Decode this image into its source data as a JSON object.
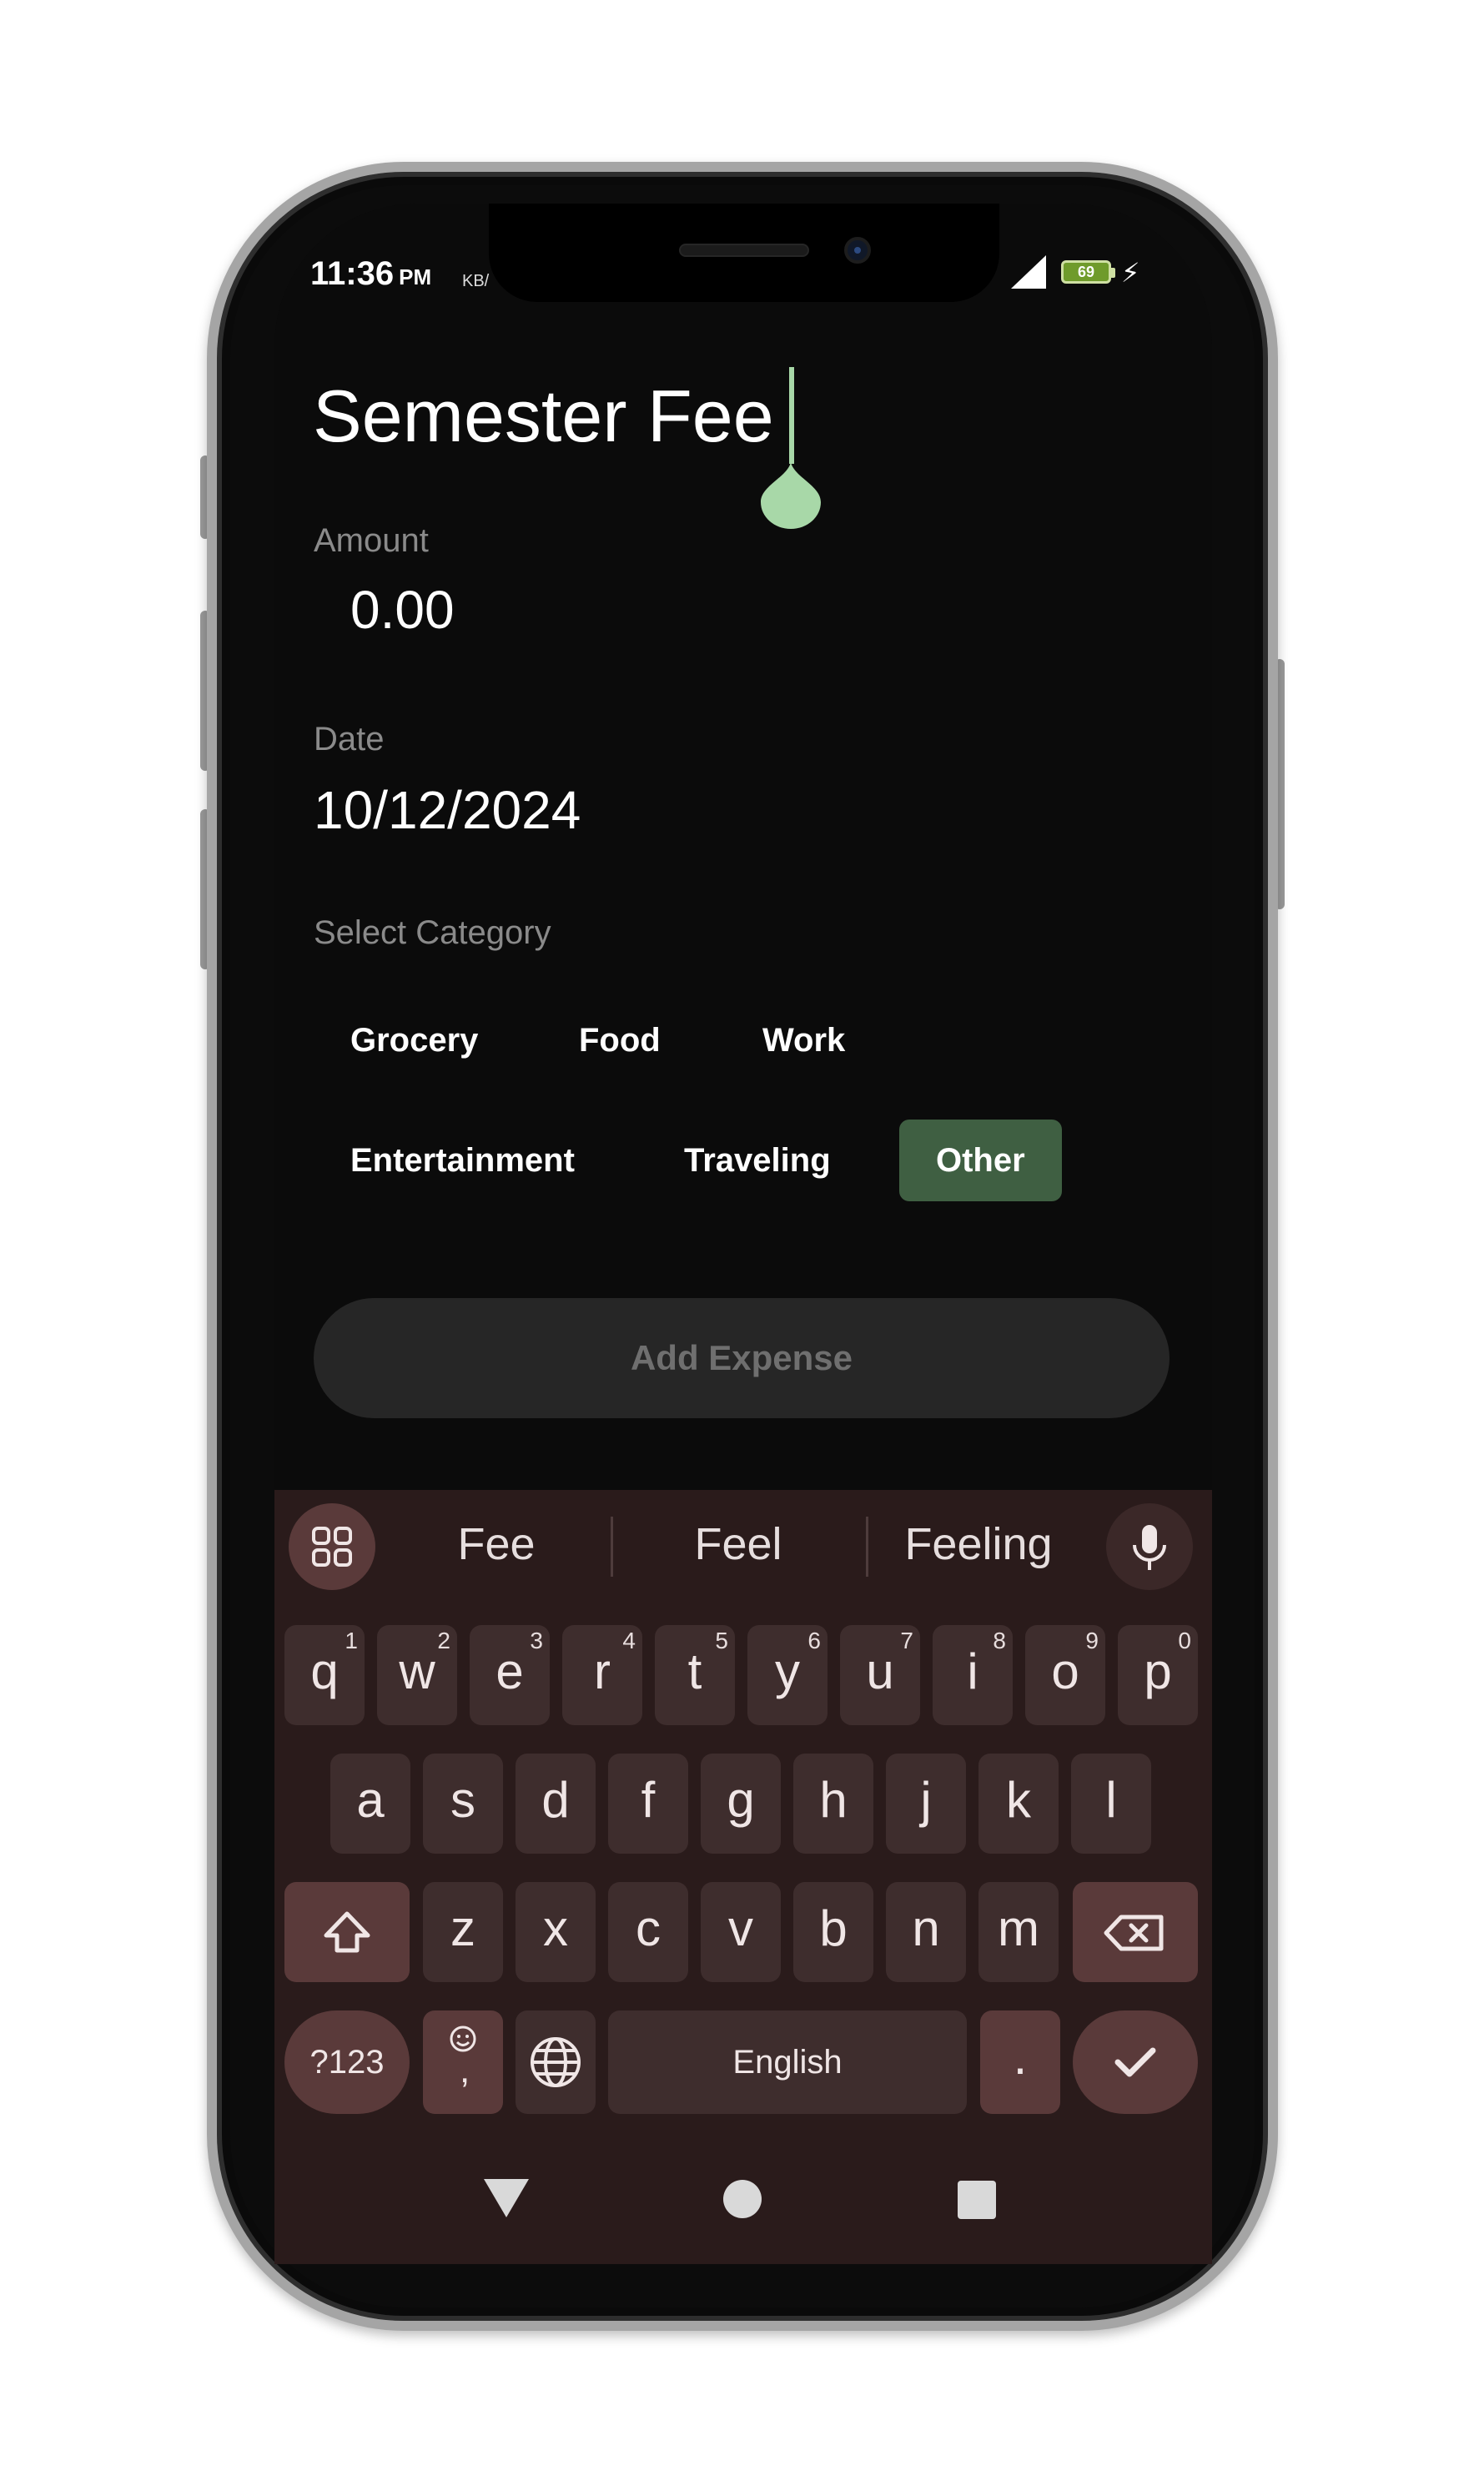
{
  "status_bar": {
    "time": "11:36",
    "ampm": "PM",
    "kb_text": "KB/",
    "battery": "69"
  },
  "form": {
    "title": "Semester Fee",
    "amount_label": "Amount",
    "amount_value": "0.00",
    "date_label": "Date",
    "date_value": "10/12/2024",
    "category_label": "Select Category",
    "categories": [
      "Grocery",
      "Food",
      "Work",
      "Entertainment",
      "Traveling",
      "Other"
    ],
    "selected_category": "Other",
    "add_button": "Add Expense"
  },
  "colors": {
    "accent": "#3f5f42",
    "cursor": "#a8d8a8",
    "keyboard_bg": "#2a1b1b",
    "key_bg": "#3e2d2d",
    "key_dark_bg": "#5a3a3a"
  },
  "keyboard": {
    "suggestions": [
      "Fee",
      "Feel",
      "Feeling"
    ],
    "row1": [
      {
        "key": "q",
        "sup": "1"
      },
      {
        "key": "w",
        "sup": "2"
      },
      {
        "key": "e",
        "sup": "3"
      },
      {
        "key": "r",
        "sup": "4"
      },
      {
        "key": "t",
        "sup": "5"
      },
      {
        "key": "y",
        "sup": "6"
      },
      {
        "key": "u",
        "sup": "7"
      },
      {
        "key": "i",
        "sup": "8"
      },
      {
        "key": "o",
        "sup": "9"
      },
      {
        "key": "p",
        "sup": "0"
      }
    ],
    "row2": [
      "a",
      "s",
      "d",
      "f",
      "g",
      "h",
      "j",
      "k",
      "l"
    ],
    "row3": [
      "z",
      "x",
      "c",
      "v",
      "b",
      "n",
      "m"
    ],
    "symbols_key": "?123",
    "space_label": "English",
    "period": "."
  },
  "icons": {
    "grid": "grid-icon",
    "mic": "mic-icon",
    "shift": "shift-icon",
    "backspace": "backspace-icon",
    "emoji": "emoji-icon",
    "globe": "globe-icon",
    "check": "check-icon",
    "nav_back": "triangle-back-icon",
    "nav_home": "circle-home-icon",
    "nav_recents": "square-recents-icon"
  }
}
